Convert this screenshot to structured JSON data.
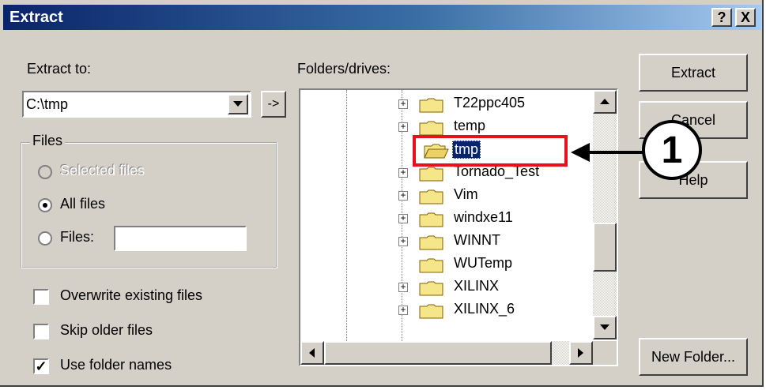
{
  "window": {
    "title": "Extract",
    "help_btn": "?",
    "close_btn": "X"
  },
  "extract_to": {
    "label": "Extract to:",
    "value": "C:\\tmp",
    "browse_btn": "->"
  },
  "files_group": {
    "legend": "Files",
    "selected_files": "Selected files",
    "all_files": "All files",
    "files": "Files:",
    "files_value": ""
  },
  "options": {
    "overwrite": "Overwrite existing files",
    "skip_older": "Skip older files",
    "use_folder_names": "Use folder names"
  },
  "folders": {
    "label": "Folders/drives:",
    "items": [
      {
        "name": "T22ppc405",
        "expander": "+"
      },
      {
        "name": "temp",
        "expander": "+"
      },
      {
        "name": "tmp",
        "expander": ""
      },
      {
        "name": "Tornado_Test",
        "expander": "+"
      },
      {
        "name": "Vim",
        "expander": "+"
      },
      {
        "name": "windxe11",
        "expander": "+"
      },
      {
        "name": "WINNT",
        "expander": "+"
      },
      {
        "name": "WUTemp",
        "expander": ""
      },
      {
        "name": "XILINX",
        "expander": "+"
      },
      {
        "name": "XILINX_6",
        "expander": "+"
      }
    ]
  },
  "buttons": {
    "extract": "Extract",
    "cancel": "Cancel",
    "help": "Help",
    "new_folder": "New Folder..."
  },
  "callout": {
    "number": "1"
  },
  "colors": {
    "highlight_box": "#e8101a",
    "selection": "#0a246a",
    "title_start": "#0a246a",
    "title_end": "#a6caf0"
  }
}
